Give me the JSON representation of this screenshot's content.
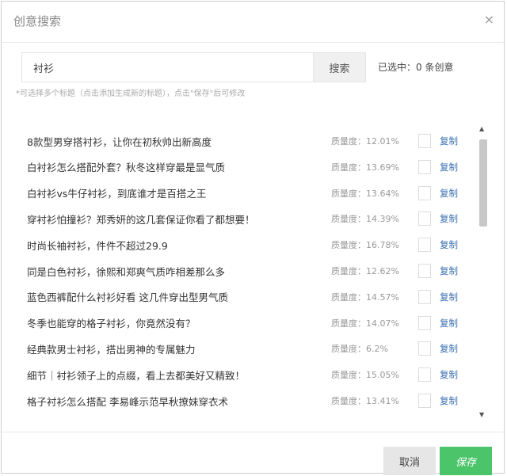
{
  "dialog": {
    "title": "创意搜索",
    "close_glyph": "×"
  },
  "search": {
    "value": "衬衫",
    "button_label": "搜索"
  },
  "selected": "已选中：0 条创意",
  "hint": "*可选择多个标题（点击添加生成新的标题），点击\"保存\"后可修改",
  "list": {
    "copy_label": "复制",
    "items": [
      {
        "title": "8款型男穿搭衬衫，让你在初秋帅出新高度",
        "meta": "质量度：12.01%"
      },
      {
        "title": "白衬衫怎么搭配外套？秋冬这样穿最是显气质",
        "meta": "质量度：13.69%"
      },
      {
        "title": "白衬衫vs牛仔衬衫，到底谁才是百搭之王",
        "meta": "质量度：13.64%"
      },
      {
        "title": "穿衬衫怕撞衫？郑秀妍的这几套保证你看了都想要！",
        "meta": "质量度：14.39%"
      },
      {
        "title": "时尚长袖衬衫，件件不超过29.9",
        "meta": "质量度：16.78%"
      },
      {
        "title": "同是白色衬衫，徐熙和郑爽气质咋相差那么多",
        "meta": "质量度：12.62%"
      },
      {
        "title": "蓝色西裤配什么衬衫好看 这几件穿出型男气质",
        "meta": "质量度：14.57%"
      },
      {
        "title": "冬季也能穿的格子衬衫，你竟然没有？",
        "meta": "质量度：14.07%"
      },
      {
        "title": "经典款男士衬衫，搭出男神的专属魅力",
        "meta": "质量度：6.2%"
      },
      {
        "title": "细节｜衬衫领子上的点缀，看上去都美好又精致！",
        "meta": "质量度：15.05%"
      },
      {
        "title": "格子衬衫怎么搭配 李易峰示范早秋撩妹穿衣术",
        "meta": "质量度：13.41%"
      }
    ]
  },
  "footer": {
    "cancel_label": "取消",
    "save_label": "保存"
  }
}
